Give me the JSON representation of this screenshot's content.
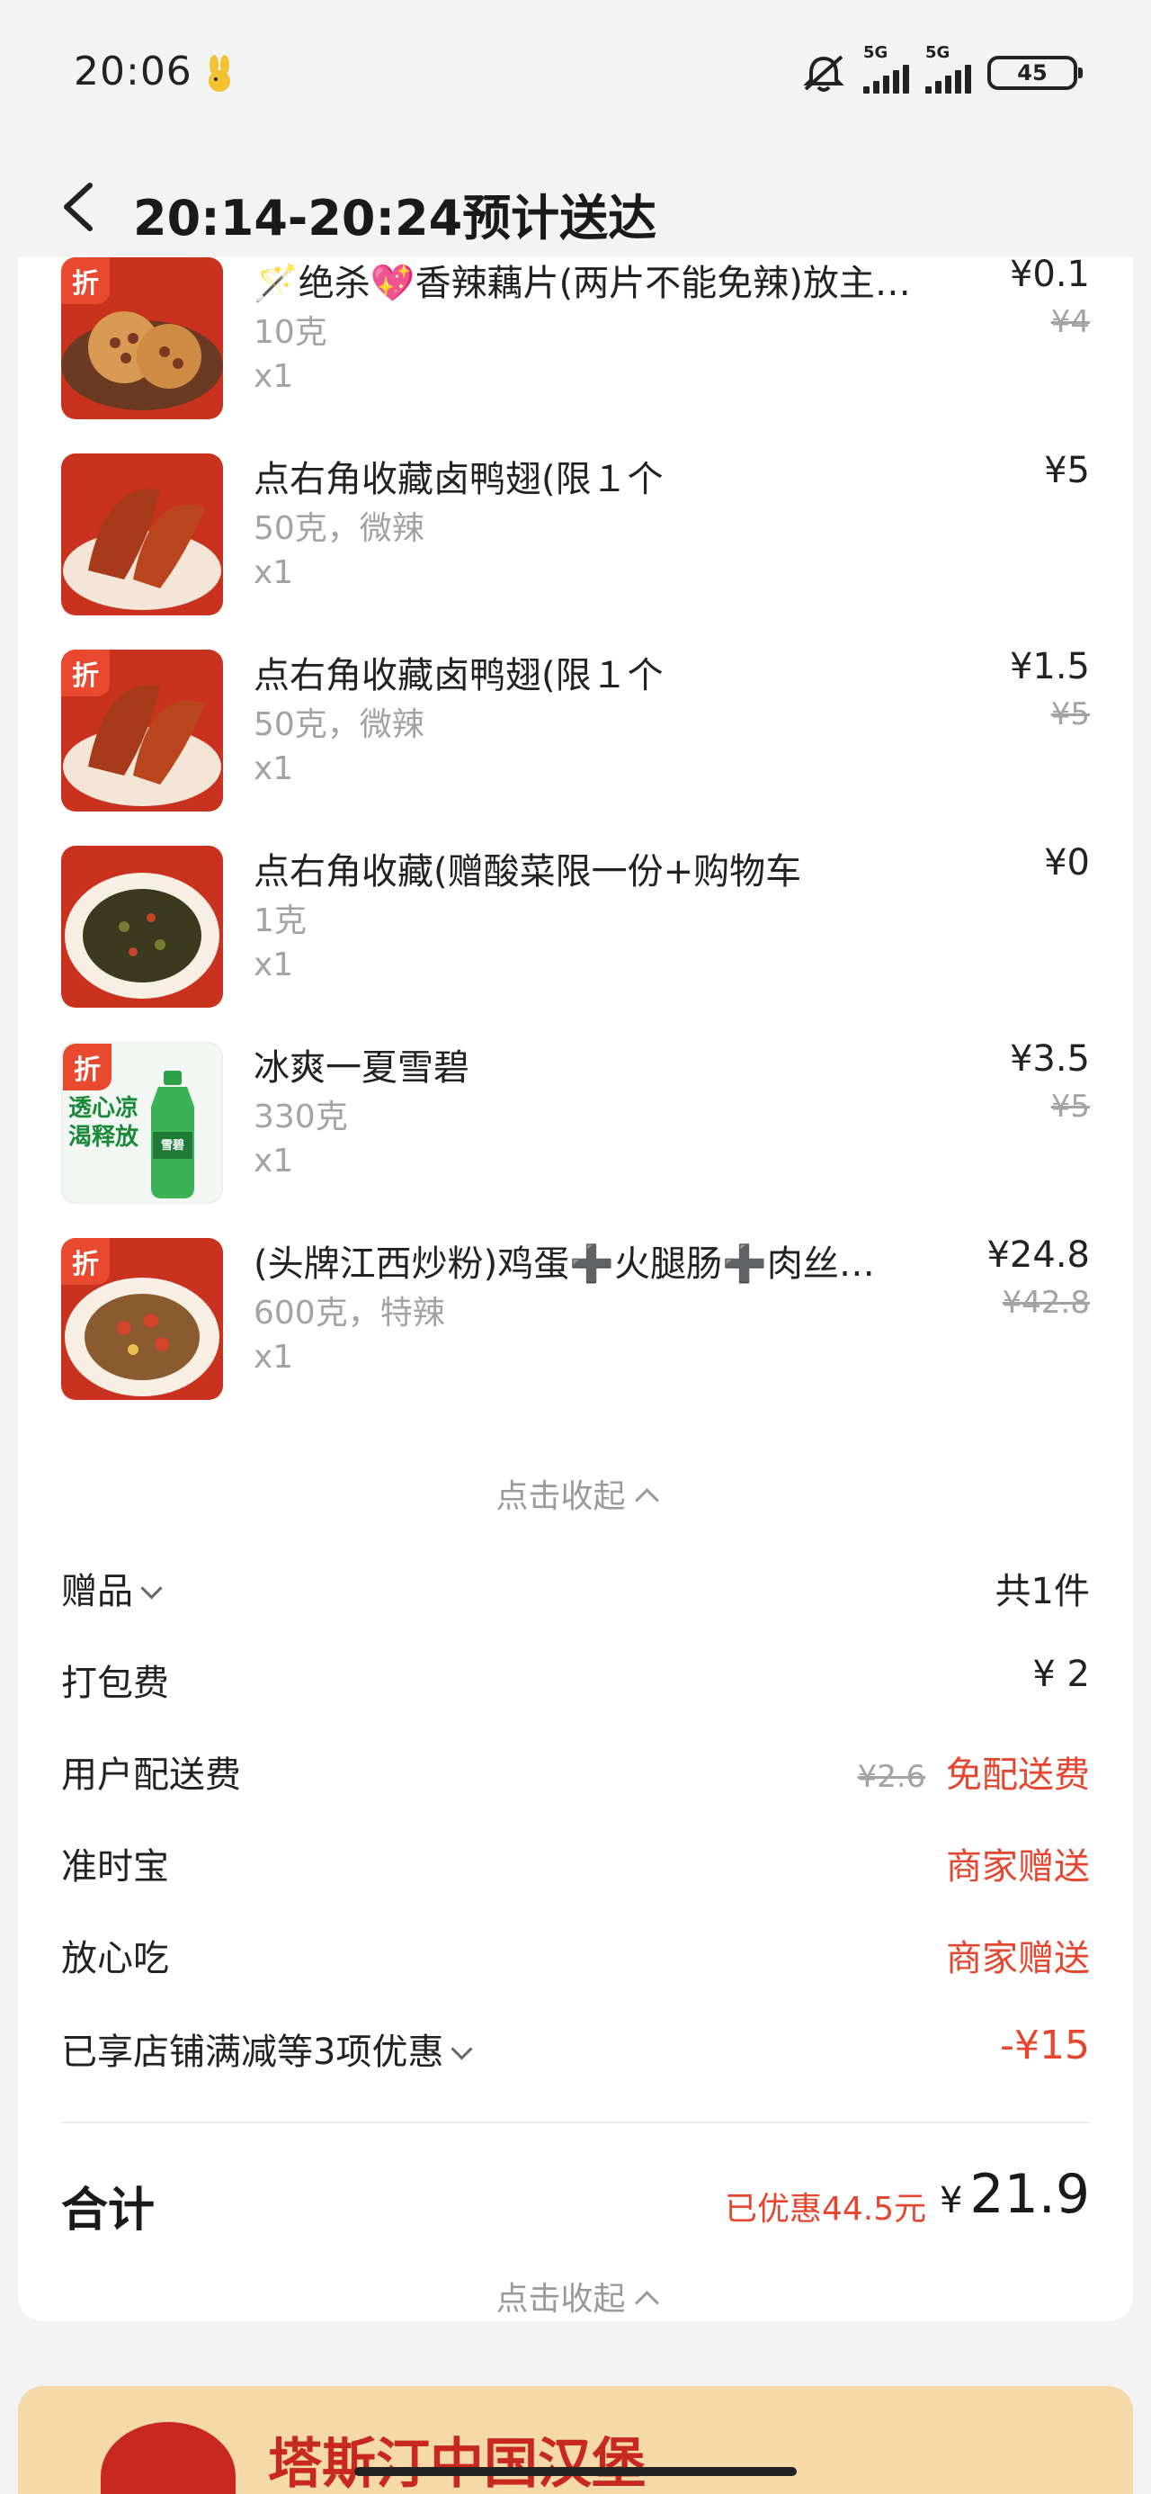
{
  "status_bar": {
    "time": "20:06",
    "net1": "5G",
    "net2": "5G",
    "battery": "45"
  },
  "header": {
    "title": "20:14-20:24预计送达"
  },
  "items": [
    {
      "badge": "折",
      "name": "🪄绝杀💖香辣藕片(两片不能免辣)放主…",
      "spec": "10克",
      "qty": "x1",
      "price": "¥0.1",
      "orig": "¥4"
    },
    {
      "badge": "",
      "name": "点右角收藏卤鸭翅(限１个",
      "spec": "50克，微辣",
      "qty": "x1",
      "price": "¥5",
      "orig": ""
    },
    {
      "badge": "折",
      "name": "点右角收藏卤鸭翅(限１个",
      "spec": "50克，微辣",
      "qty": "x1",
      "price": "¥1.5",
      "orig": "¥5"
    },
    {
      "badge": "",
      "name": "点右角收藏(赠酸菜限一份+购物车",
      "spec": "1克",
      "qty": "x1",
      "price": "¥0",
      "orig": ""
    },
    {
      "badge": "折",
      "name": "冰爽一夏雪碧",
      "spec": "330克",
      "qty": "x1",
      "price": "¥3.5",
      "orig": "¥5",
      "thumb_text": "透心凉 渴释放",
      "bottle_label": "雪碧"
    },
    {
      "badge": "折",
      "name": "(头牌江西炒粉)鸡蛋➕火腿肠➕肉丝…",
      "spec": "600克，特辣",
      "qty": "x1",
      "price": "¥24.8",
      "orig": "¥42.8"
    }
  ],
  "collapse_label": "点击收起",
  "summary": {
    "gift": {
      "label": "赠品",
      "value": "共1件"
    },
    "packing": {
      "label": "打包费",
      "value": "¥ 2"
    },
    "delivery": {
      "label": "用户配送费",
      "orig": "¥2.6",
      "value": "免配送费"
    },
    "ontime": {
      "label": "准时宝",
      "value": "商家赠送"
    },
    "safe": {
      "label": "放心吃",
      "value": "商家赠送"
    },
    "discount": {
      "label": "已享店铺满减等3项优惠",
      "value": "-¥15"
    }
  },
  "total": {
    "label": "合计",
    "saved": "已优惠44.5元",
    "currency": "¥",
    "amount": "21.9"
  },
  "collapse_label_2": "点击收起",
  "banner": {
    "text": "塔斯汀中国汉堡"
  }
}
